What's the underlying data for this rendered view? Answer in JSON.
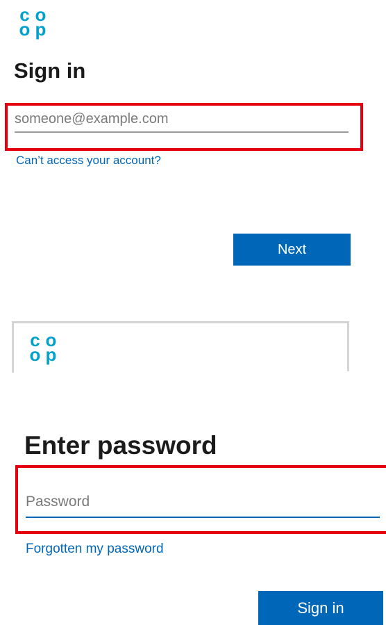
{
  "brand": {
    "logo_letters": [
      "c",
      "o",
      "o",
      "p"
    ],
    "accent_color": "#00a1cc",
    "button_color": "#0067b8",
    "highlight_color": "#e4000f"
  },
  "signin_screen": {
    "title": "Sign in",
    "email_placeholder": "someone@example.com",
    "cant_access_link": "Can’t access your account?",
    "next_button": "Next"
  },
  "password_screen": {
    "title": "Enter password",
    "password_placeholder": "Password",
    "forgot_link": "Forgotten my password",
    "signin_button": "Sign in"
  }
}
